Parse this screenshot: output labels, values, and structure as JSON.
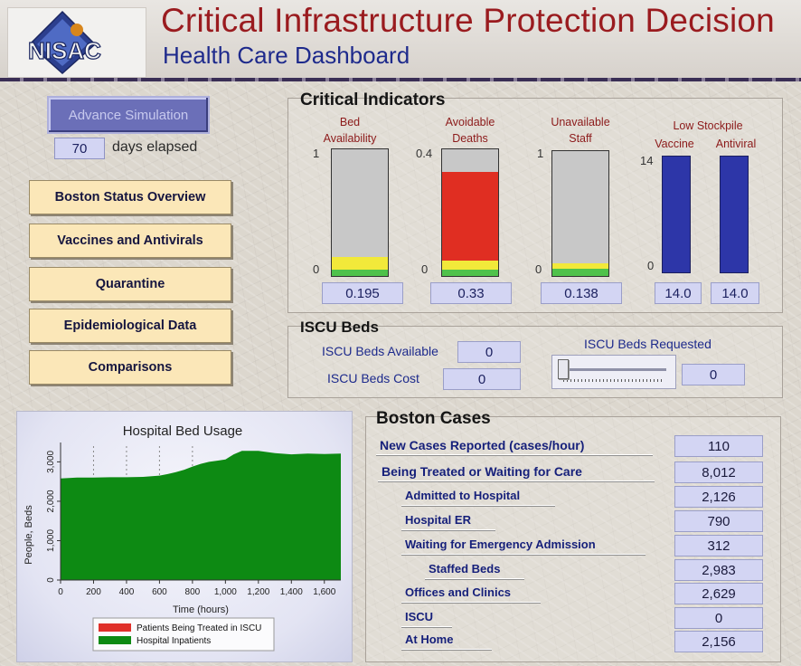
{
  "header": {
    "logo_text": "NISAC",
    "title": "Critical Infrastructure Protection Decision",
    "subtitle": "Health Care Dashboard"
  },
  "controls": {
    "advance_label": "Advance Simulation",
    "days_value": "70",
    "days_label": "days elapsed"
  },
  "nav": [
    {
      "label": "Boston Status Overview"
    },
    {
      "label": "Vaccines and Antivirals"
    },
    {
      "label": "Quarantine"
    },
    {
      "label": "Epidemiological Data"
    },
    {
      "label": "Comparisons"
    }
  ],
  "indicators": {
    "title": "Critical Indicators",
    "bed": {
      "label1": "Bed",
      "label2": "Availability",
      "max": "1",
      "min": "0",
      "value": "0.195",
      "yellow_level": 0.15,
      "green_level": 0.05
    },
    "deaths": {
      "label1": "Avoidable",
      "label2": "Deaths",
      "max": "0.4",
      "min": "0",
      "value": "0.33",
      "red_level": 0.82,
      "yellow_level": 0.12,
      "green_level": 0.05
    },
    "staff": {
      "label1": "Unavailable",
      "label2": "Staff",
      "max": "1",
      "min": "0",
      "value": "0.138",
      "yellow_level": 0.1,
      "green_level": 0.06
    },
    "stockpile": {
      "label": "Low Stockpile",
      "vaccine_label": "Vaccine",
      "antiviral_label": "Antiviral",
      "max": "14",
      "min": "0",
      "vaccine_value": "14.0",
      "antiviral_value": "14.0"
    }
  },
  "iscu": {
    "title": "ISCU Beds",
    "available_label": "ISCU Beds Available",
    "available_value": "0",
    "cost_label": "ISCU Beds Cost",
    "cost_value": "0",
    "requested_label": "ISCU Beds Requested",
    "requested_value": "0",
    "slider_level": 0
  },
  "cases": {
    "title": "Boston Cases",
    "rows": [
      {
        "label": "New Cases Reported (cases/hour)",
        "value": "110"
      },
      {
        "label": "Being Treated or Waiting for Care",
        "value": "8,012"
      },
      {
        "label": "Admitted to Hospital",
        "value": "2,126"
      },
      {
        "label": "Hospital ER",
        "value": "790"
      },
      {
        "label": "Waiting for Emergency Admission",
        "value": "312"
      },
      {
        "label": "Staffed Beds",
        "value": "2,983"
      },
      {
        "label": "Offices and Clinics",
        "value": "2,629"
      },
      {
        "label": "ISCU",
        "value": "0"
      },
      {
        "label": "At Home",
        "value": "2,156"
      }
    ]
  },
  "chart_data": {
    "type": "area",
    "title": "Hospital Bed Usage",
    "xlabel": "Time (hours)",
    "ylabel": "People, Beds",
    "xlim": [
      0,
      1700
    ],
    "ylim": [
      0,
      3400
    ],
    "xticks": [
      "0",
      "200",
      "400",
      "600",
      "800",
      "1,000",
      "1,200",
      "1,400",
      "1,600"
    ],
    "xtick_values": [
      0,
      200,
      400,
      600,
      800,
      1000,
      1200,
      1400,
      1600
    ],
    "yticks": [
      "0",
      "1,000",
      "2,000",
      "3,000"
    ],
    "ytick_values": [
      0,
      1000,
      2000,
      3000
    ],
    "series": [
      {
        "name": "Patients Being Treated in ISCU",
        "color": "#e0302a",
        "x": [
          0,
          1700
        ],
        "y": [
          0,
          0
        ]
      },
      {
        "name": "Hospital Inpatients",
        "color": "#0d8a13",
        "x": [
          0,
          100,
          200,
          300,
          400,
          500,
          600,
          650,
          700,
          750,
          800,
          850,
          900,
          950,
          1000,
          1050,
          1100,
          1200,
          1300,
          1400,
          1500,
          1600,
          1700
        ],
        "y": [
          2580,
          2600,
          2600,
          2610,
          2610,
          2620,
          2650,
          2690,
          2740,
          2800,
          2880,
          2950,
          3000,
          3030,
          3060,
          3190,
          3280,
          3280,
          3220,
          3190,
          3210,
          3200,
          3210
        ]
      }
    ],
    "grid": "vertical dashed",
    "legend": "bottom"
  }
}
